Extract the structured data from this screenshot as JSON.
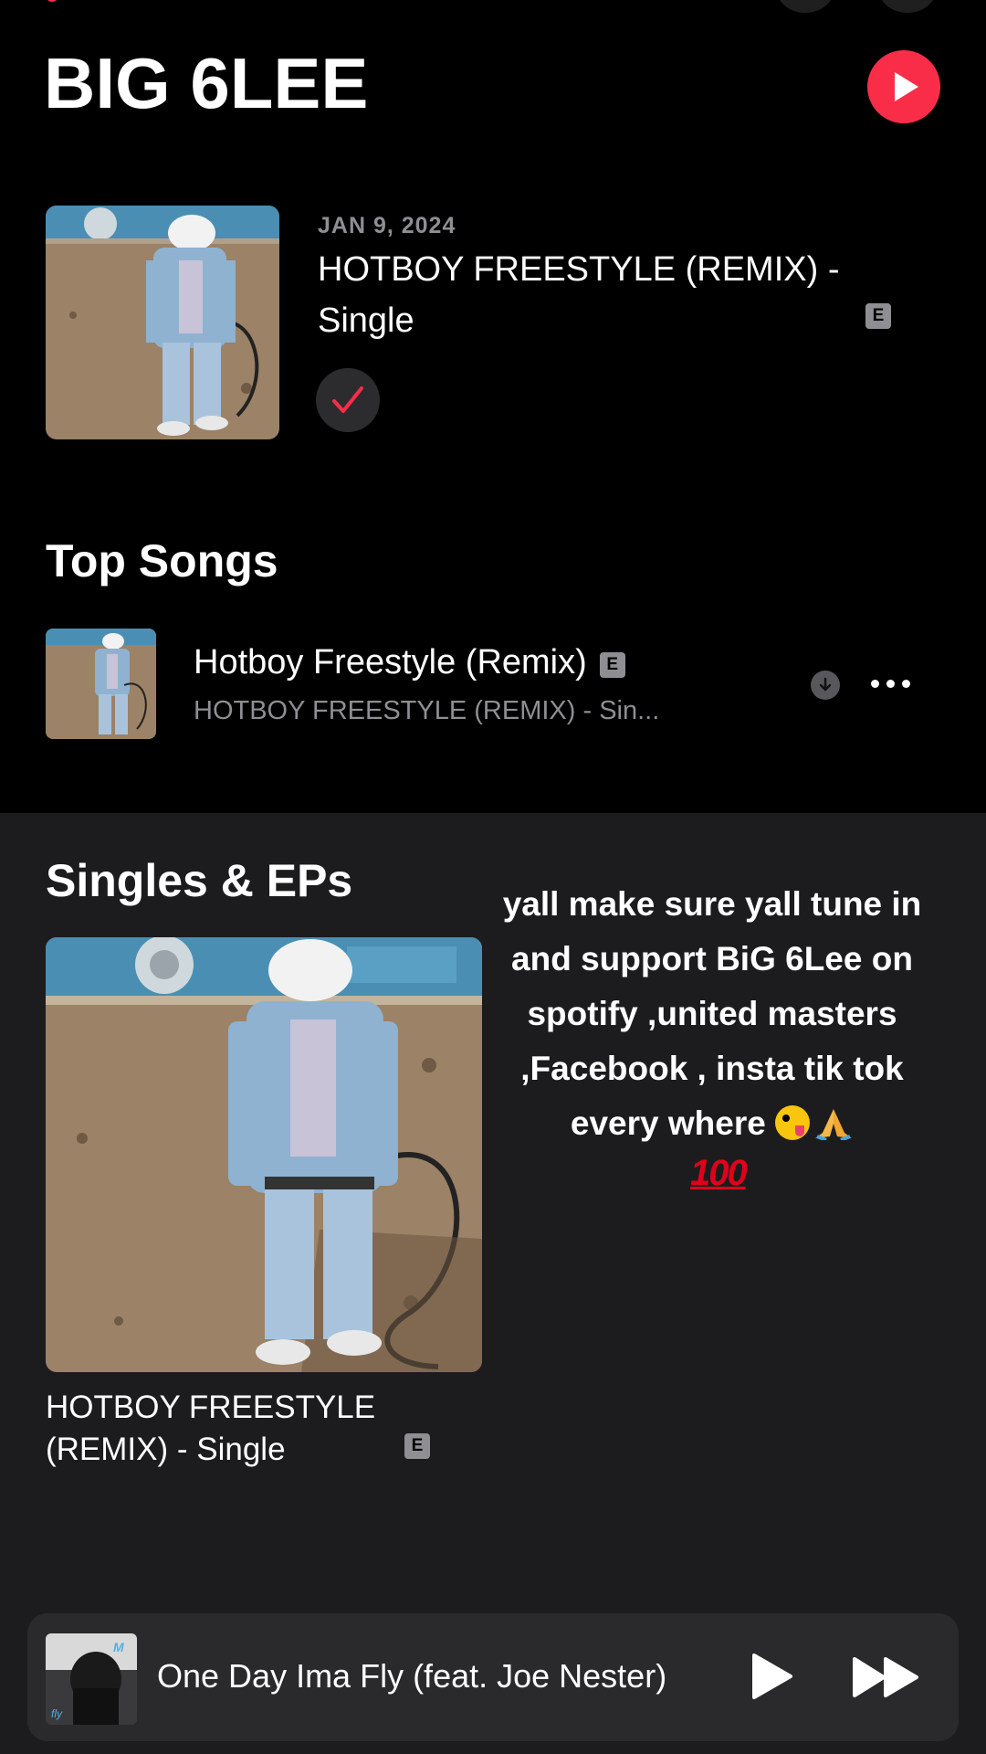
{
  "header": {
    "artist_name": "BIG 6LEE"
  },
  "latest_release": {
    "date": "JAN 9, 2024",
    "title": "HOTBOY FREESTYLE (REMIX) - Single",
    "explicit_badge": "E"
  },
  "top_songs": {
    "section_title": "Top Songs",
    "items": [
      {
        "title": "Hotboy Freestyle (Remix)",
        "explicit_badge": "E",
        "subtitle": "HOTBOY FREESTYLE (REMIX) - Sin..."
      }
    ]
  },
  "singles": {
    "section_title": "Singles & EPs",
    "items": [
      {
        "title": "HOTBOY FREESTYLE (REMIX) - Single",
        "explicit_badge": "E"
      }
    ]
  },
  "overlay": {
    "text": "yall make sure yall tune in and support BiG 6Lee on spotify ,united masters ,Facebook , insta tik tok every where",
    "emoji_100": "100"
  },
  "mini_player": {
    "title": "One Day Ima Fly (feat. Joe Nester)"
  },
  "icons": {
    "play_artist": "play-icon",
    "added": "checkmark-icon",
    "download": "download-icon",
    "more": "more-icon",
    "mini_play": "play-icon",
    "mini_next": "fast-forward-icon"
  },
  "colors": {
    "accent": "#fa2d48",
    "background": "#000000",
    "section_background": "#1c1c1e",
    "secondary_text": "#8e8e93",
    "mini_player_background": "#2a2a2c"
  }
}
